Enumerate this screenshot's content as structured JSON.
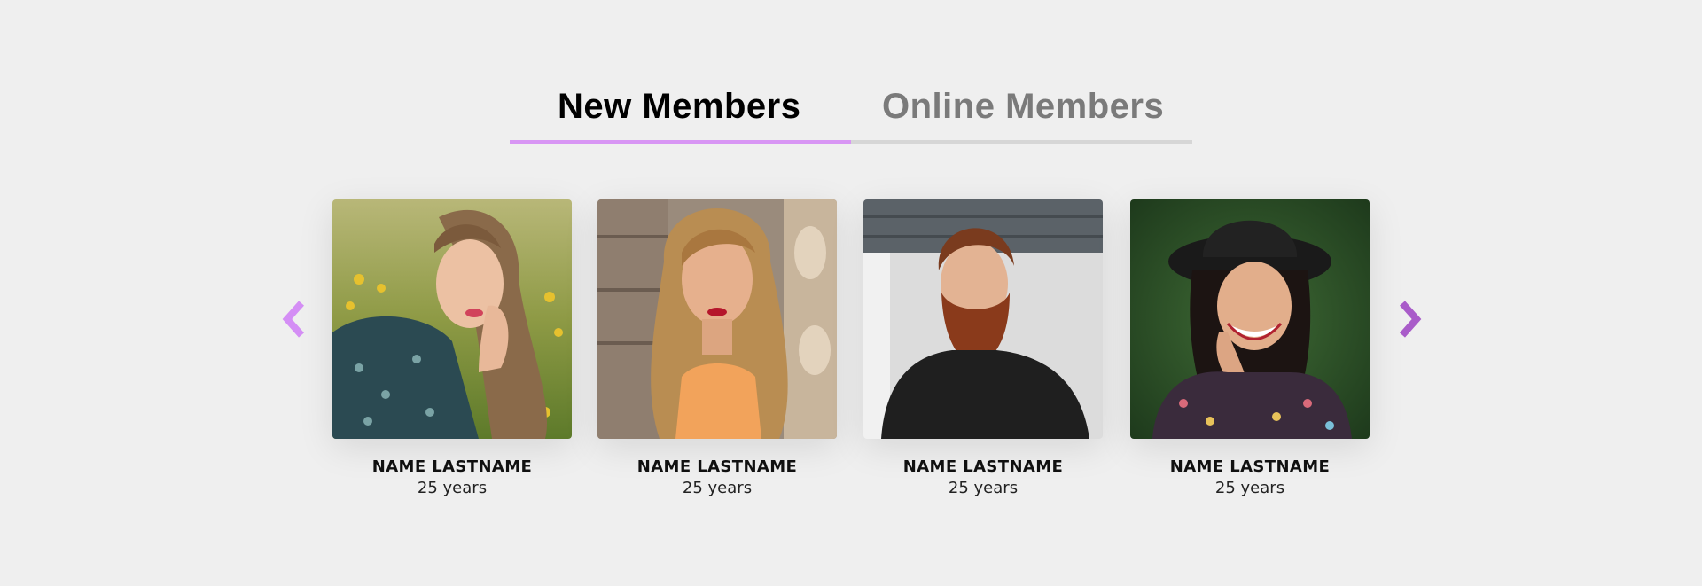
{
  "tabs": [
    {
      "label": "New Members",
      "active": true
    },
    {
      "label": "Online Members",
      "active": false
    }
  ],
  "colors": {
    "accent": "#d896f4",
    "arrow_prev": "#d48ef5",
    "arrow_next": "#a95cc9",
    "background": "#efefef",
    "inactive_tab": "#7a7a7a"
  },
  "carousel": {
    "prev_icon": "chevron-left-icon",
    "next_icon": "chevron-right-icon"
  },
  "members": [
    {
      "name": "NAME LASTNAME",
      "age": "25 years",
      "photo": "woman-lying-in-flowers"
    },
    {
      "name": "NAME LASTNAME",
      "age": "25 years",
      "photo": "woman-long-blonde-hair"
    },
    {
      "name": "NAME LASTNAME",
      "age": "25 years",
      "photo": "bearded-man"
    },
    {
      "name": "NAME LASTNAME",
      "age": "25 years",
      "photo": "smiling-woman-in-hat"
    }
  ]
}
